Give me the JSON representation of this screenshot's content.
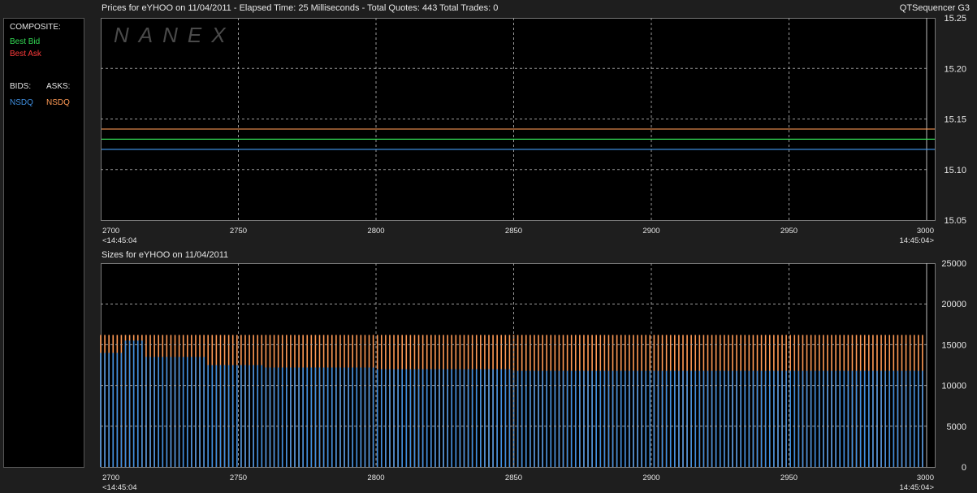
{
  "header": {
    "prices_title": "Prices for  eYHOO  on  11/04/2011  -  Elapsed Time: 25 Milliseconds  -  Total Quotes: 443  Total Trades: 0",
    "app_name": "QTSequencer G3",
    "sizes_title": "Sizes for  eYHOO  on  11/04/2011"
  },
  "legend": {
    "composite_label": "COMPOSITE:",
    "best_bid": "Best Bid",
    "best_ask": "Best Ask",
    "bids_label": "BIDS:",
    "asks_label": "ASKS:",
    "bid_exchange": "NSDQ",
    "ask_exchange": "NSDQ"
  },
  "watermark": "NANEX",
  "colors": {
    "best_bid": "#33dd55",
    "best_ask": "#ff3b3b",
    "nsdq_bid": "#3f8fe0",
    "nsdq_ask": "#ff9a55",
    "grid": "#9a9a9a"
  },
  "chart_data": [
    {
      "type": "line",
      "name": "prices",
      "xlim": [
        2700,
        3000
      ],
      "ylim": [
        15.05,
        15.25
      ],
      "x_ticks": [
        2700,
        2750,
        2800,
        2850,
        2900,
        2950,
        3000
      ],
      "y_ticks": [
        "15.25",
        "15.20",
        "15.15",
        "15.10",
        "15.05"
      ],
      "y_tick_values": [
        15.25,
        15.2,
        15.15,
        15.1,
        15.05
      ],
      "x_start_time": "<14:45:04",
      "x_end_time": "14:45:04>",
      "grid": true,
      "series": [
        {
          "label": "NSDQ ask",
          "color": "#ff9a55",
          "value": 15.14
        },
        {
          "label": "Best Bid",
          "color": "#33dd55",
          "value": 15.13
        },
        {
          "label": "NSDQ bid",
          "color": "#3f8fe0",
          "value": 15.12
        }
      ]
    },
    {
      "type": "bar",
      "name": "sizes",
      "xlim": [
        2700,
        3000
      ],
      "ylim": [
        0,
        25000
      ],
      "x_ticks": [
        2700,
        2750,
        2800,
        2850,
        2900,
        2950,
        3000
      ],
      "y_ticks": [
        "25000",
        "20000",
        "15000",
        "10000",
        "5000",
        "0"
      ],
      "y_tick_values": [
        25000,
        20000,
        15000,
        10000,
        5000,
        0
      ],
      "x_start_time": "<14:45:04",
      "x_end_time": "14:45:04>",
      "grid": true,
      "ask_size_level": 16200,
      "bid_size_profile": [
        {
          "from": 2700,
          "to": 2709,
          "value": 14000
        },
        {
          "from": 2709,
          "to": 2716,
          "value": 15500
        },
        {
          "from": 2716,
          "to": 2738,
          "value": 13500
        },
        {
          "from": 2738,
          "to": 2760,
          "value": 12500
        },
        {
          "from": 2760,
          "to": 2800,
          "value": 12200
        },
        {
          "from": 2800,
          "to": 2850,
          "value": 12000
        },
        {
          "from": 2850,
          "to": 3000,
          "value": 11800
        }
      ]
    }
  ]
}
